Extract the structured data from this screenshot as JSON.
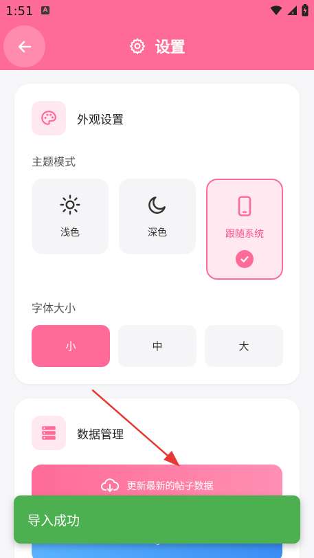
{
  "status_bar": {
    "time": "1:51",
    "notification_letter": "A",
    "icons": [
      "wifi-icon",
      "signal-icon",
      "battery-charging-icon"
    ]
  },
  "app_bar": {
    "title": "设置",
    "back_icon": "arrow-left-icon",
    "title_icon": "gear-icon",
    "color": "#ff6b98"
  },
  "appearance_card": {
    "title": "外观设置",
    "icon": "palette-icon",
    "theme_mode_label": "主题模式",
    "theme_options": [
      {
        "label": "浅色",
        "icon": "sun-icon",
        "selected": false
      },
      {
        "label": "深色",
        "icon": "moon-icon",
        "selected": false
      },
      {
        "label": "跟随系统",
        "icon": "phone-icon",
        "selected": true
      }
    ],
    "font_size_label": "字体大小",
    "font_sizes": [
      {
        "label": "小",
        "selected": true
      },
      {
        "label": "中",
        "selected": false
      },
      {
        "label": "大",
        "selected": false
      }
    ]
  },
  "data_card": {
    "title": "数据管理",
    "icon": "database-icon",
    "update_button_label": "更新最新的帖子数据",
    "update_button_icon": "cloud-download-icon",
    "export_button_label": "导"
  },
  "toast": {
    "message": "导入成功",
    "color": "#4caf50"
  },
  "annotation": {
    "color": "#e53935"
  }
}
